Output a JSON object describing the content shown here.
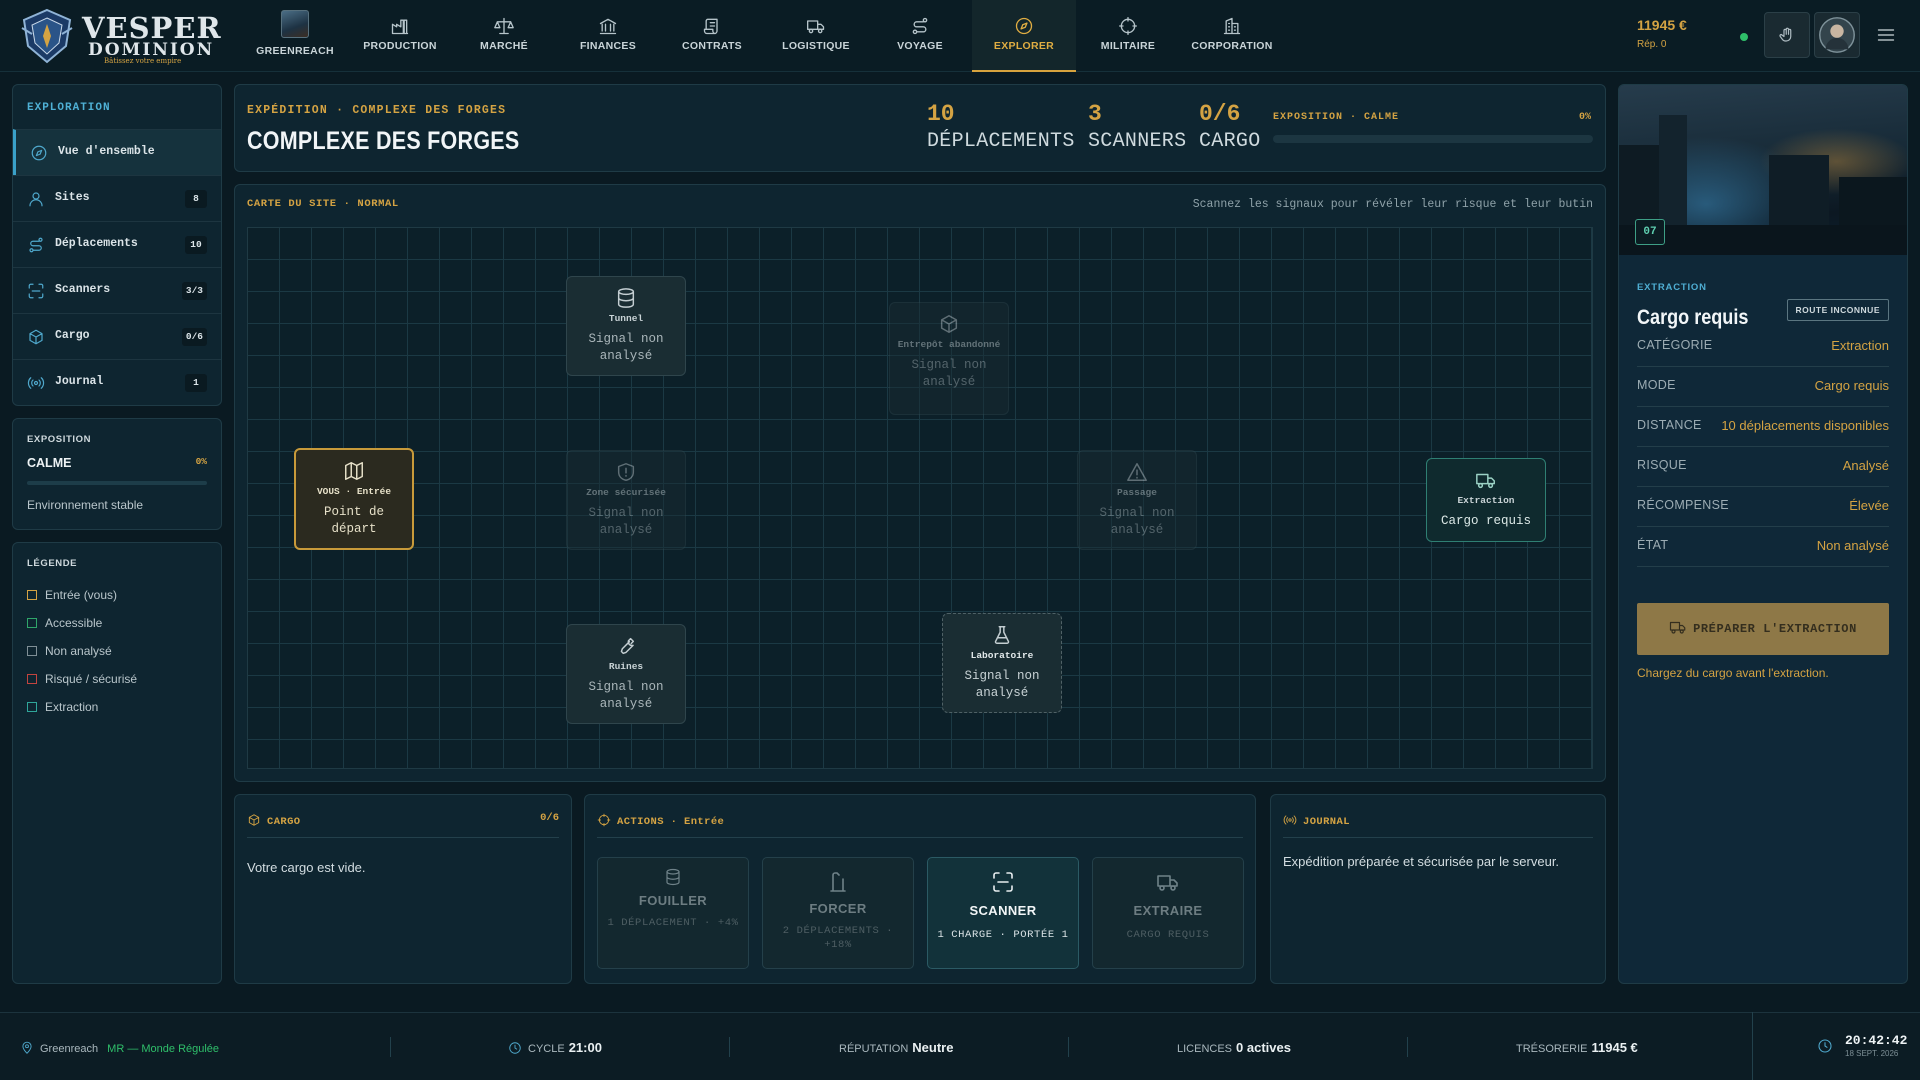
{
  "brand": {
    "name": "VESPER",
    "sub": "DOMINION",
    "tagline": "Bâtissez votre empire"
  },
  "nav": {
    "greenreach": "GREENREACH",
    "items": [
      {
        "label": "PRODUCTION",
        "icon": "factory-icon"
      },
      {
        "label": "MARCHÉ",
        "icon": "scale-icon"
      },
      {
        "label": "FINANCES",
        "icon": "bank-icon"
      },
      {
        "label": "CONTRATS",
        "icon": "scroll-icon"
      },
      {
        "label": "LOGISTIQUE",
        "icon": "truck-icon"
      },
      {
        "label": "VOYAGE",
        "icon": "route-icon"
      },
      {
        "label": "EXPLORER",
        "icon": "compass-icon",
        "active": true
      },
      {
        "label": "MILITAIRE",
        "icon": "crosshair-icon"
      },
      {
        "label": "CORPORATION",
        "icon": "building-icon"
      }
    ]
  },
  "account": {
    "money": "11945 €",
    "reputation": "Rép. 0"
  },
  "sidebar": {
    "title": "EXPLORATION",
    "items": [
      {
        "label": "Vue d'ensemble",
        "badge": "",
        "icon": "compass-icon"
      },
      {
        "label": "Sites",
        "badge": "8",
        "icon": "user-icon"
      },
      {
        "label": "Déplacements",
        "badge": "10",
        "icon": "route-icon"
      },
      {
        "label": "Scanners",
        "badge": "3/3",
        "icon": "scan-icon"
      },
      {
        "label": "Cargo",
        "badge": "0/6",
        "icon": "box-icon"
      },
      {
        "label": "Journal",
        "badge": "1",
        "icon": "signal-icon"
      }
    ]
  },
  "exposure": {
    "label": "EXPOSITION",
    "state": "CALME",
    "pct": "0%",
    "level": 0,
    "note": "Environnement stable"
  },
  "legend": {
    "title": "LÉGENDE",
    "items": [
      {
        "label": "Entrée (vous)",
        "color": "#d4a343"
      },
      {
        "label": "Accessible",
        "color": "#2fa66a"
      },
      {
        "label": "Non analysé",
        "color": "#7f8f96"
      },
      {
        "label": "Risqué / sécurisé",
        "color": "#c2443f"
      },
      {
        "label": "Extraction",
        "color": "#2fa69a"
      }
    ]
  },
  "header": {
    "subtitle": "EXPÉDITION · COMPLEXE DES FORGES",
    "title": "COMPLEXE DES FORGES",
    "stats": [
      {
        "value": "10",
        "label": "DÉPLACEMENTS"
      },
      {
        "value": "3",
        "label": "SCANNERS"
      },
      {
        "value": "0/6",
        "label": "CARGO"
      }
    ],
    "exposure_label": "EXPOSITION · CALME",
    "exposure_pct": "0%",
    "exposure_level": 0
  },
  "map": {
    "title": "CARTE DU SITE · NORMAL",
    "hint": "Scannez les signaux pour révéler leur risque et leur butin",
    "nodes": [
      {
        "name": "Tunnel",
        "status": "Signal non analysé",
        "icon": "database-icon"
      },
      {
        "name": "Entrepôt abandonné",
        "status": "Signal non analysé",
        "icon": "box-icon"
      },
      {
        "name": "VOUS · Entrée",
        "status": "Point de départ",
        "icon": "map-icon"
      },
      {
        "name": "Zone sécurisée",
        "status": "Signal non analysé",
        "icon": "shield-icon"
      },
      {
        "name": "Passage",
        "status": "Signal non analysé",
        "icon": "warning-icon"
      },
      {
        "name": "Extraction",
        "status": "Cargo requis",
        "icon": "truck-icon"
      },
      {
        "name": "Ruines",
        "status": "Signal non analysé",
        "icon": "wrench-icon"
      },
      {
        "name": "Laboratoire",
        "status": "Signal non analysé",
        "icon": "flask-icon"
      }
    ]
  },
  "cargo": {
    "title": "CARGO",
    "count": "0/6",
    "empty": "Votre cargo est vide."
  },
  "actions": {
    "title": "ACTIONS",
    "context": "Entrée",
    "items": [
      {
        "label": "FOUILLER",
        "sub": "1 DÉPLACEMENT · +4%",
        "icon": "database-icon"
      },
      {
        "label": "FORCER",
        "sub": "2 DÉPLACEMENTS · +18%",
        "icon": "crowbar-icon"
      },
      {
        "label": "SCANNER",
        "sub": "1 CHARGE · PORTÉE 1",
        "icon": "scan-icon"
      },
      {
        "label": "EXTRAIRE",
        "sub": "CARGO REQUIS",
        "icon": "truck-icon"
      }
    ]
  },
  "journal": {
    "title": "JOURNAL",
    "message": "Expédition préparée et sécurisée par le serveur."
  },
  "detail": {
    "badge": "07",
    "kind": "EXTRACTION",
    "title": "Cargo requis",
    "route": "ROUTE INCONNUE",
    "rows": [
      {
        "key": "CATÉGORIE",
        "value": "Extraction"
      },
      {
        "key": "MODE",
        "value": "Cargo requis"
      },
      {
        "key": "DISTANCE",
        "value": "10 déplacements disponibles"
      },
      {
        "key": "RISQUE",
        "value": "Analysé"
      },
      {
        "key": "RÉCOMPENSE",
        "value": "Élevée"
      },
      {
        "key": "ÉTAT",
        "value": "Non analysé"
      }
    ],
    "button": "PRÉPARER L'EXTRACTION",
    "note": "Chargez du cargo avant l'extraction."
  },
  "footer": {
    "location": "Greenreach",
    "world": "MR — Monde Régulée",
    "cycle_label": "CYCLE",
    "cycle": "21:00",
    "rep_label": "RÉPUTATION",
    "rep": "Neutre",
    "lic_label": "LICENCES",
    "lic": "0 actives",
    "treasury_label": "TRÉSORERIE",
    "treasury": "11945 €",
    "time": "20:42:42",
    "date": "18 SEPT. 2026"
  }
}
